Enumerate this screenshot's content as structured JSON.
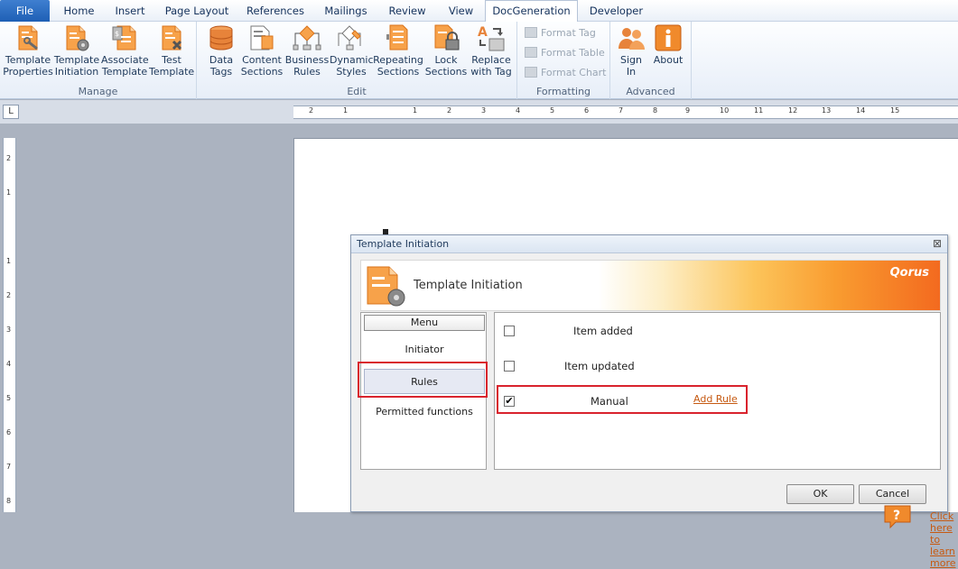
{
  "tabs": [
    "File",
    "Home",
    "Insert",
    "Page Layout",
    "References",
    "Mailings",
    "Review",
    "View",
    "DocGeneration",
    "Developer"
  ],
  "ribbon": {
    "manage": {
      "label": "Manage",
      "buttons": [
        {
          "line1": "Template",
          "line2": "Properties"
        },
        {
          "line1": "Template",
          "line2": "Initiation"
        },
        {
          "line1": "Associate",
          "line2": "Template"
        },
        {
          "line1": "Test",
          "line2": "Template"
        }
      ]
    },
    "edit": {
      "label": "Edit",
      "buttons": [
        {
          "line1": "Data",
          "line2": "Tags"
        },
        {
          "line1": "Content",
          "line2": "Sections"
        },
        {
          "line1": "Business",
          "line2": "Rules"
        },
        {
          "line1": "Dynamic",
          "line2": "Styles"
        },
        {
          "line1": "Repeating",
          "line2": "Sections"
        },
        {
          "line1": "Lock",
          "line2": "Sections"
        },
        {
          "line1": "Replace",
          "line2": "with Tag"
        }
      ]
    },
    "formatting": {
      "label": "Formatting",
      "buttons": [
        "Format Tag",
        "Format Table",
        "Format Chart"
      ]
    },
    "advanced": {
      "label": "Advanced",
      "buttons": [
        {
          "line1": "Sign",
          "line2": "In"
        },
        {
          "line1": "About",
          "line2": ""
        }
      ]
    }
  },
  "ruler": {
    "corner": "L",
    "h_ticks": [
      "2",
      "1",
      "1",
      "2",
      "3",
      "4",
      "5",
      "6",
      "7",
      "8",
      "9",
      "10",
      "11",
      "12",
      "13",
      "14",
      "15"
    ],
    "v_ticks": [
      "2",
      "1",
      "1",
      "2",
      "3",
      "4",
      "5",
      "6",
      "7",
      "8"
    ]
  },
  "dialog": {
    "title": "Template Initiation",
    "close": "⊠",
    "banner_title": "Template Initiation",
    "brand": "Qorus",
    "menu": {
      "header": "Menu",
      "items": [
        "Initiator",
        "Rules",
        "Permitted functions"
      ]
    },
    "rules": [
      {
        "label": "Item added",
        "checked": false,
        "mark": ""
      },
      {
        "label": "Item updated",
        "checked": false,
        "mark": ""
      },
      {
        "label": "Manual",
        "checked": true,
        "mark": "✔"
      }
    ],
    "add_rule": "Add Rule",
    "help_icon": "?",
    "learn_more": "Click here to learn more",
    "ok": "OK",
    "cancel": "Cancel"
  },
  "colors": {
    "accent": "#f36a1f",
    "highlight": "#d9232d",
    "link": "#c65a12"
  }
}
